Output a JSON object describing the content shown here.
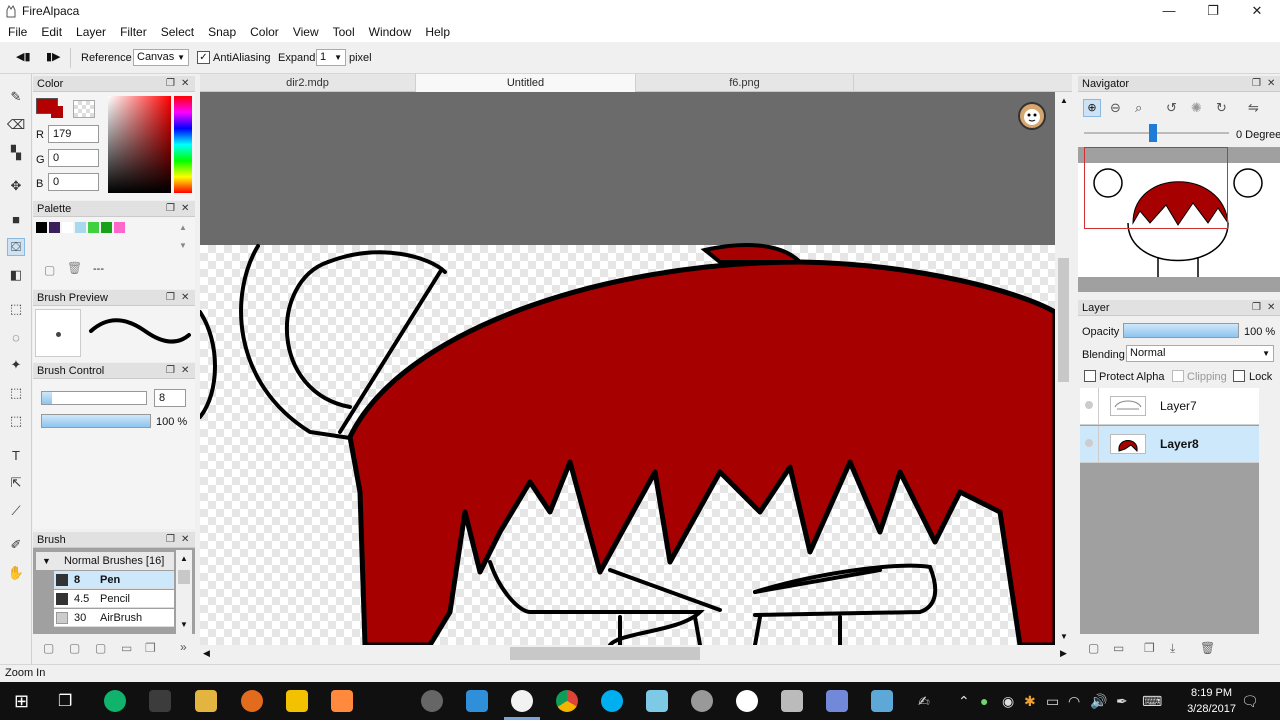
{
  "window": {
    "title": "FireAlpaca",
    "min": "—",
    "max": "❐",
    "close": "✕"
  },
  "menu": [
    "File",
    "Edit",
    "Layer",
    "Filter",
    "Select",
    "Snap",
    "Color",
    "View",
    "Tool",
    "Window",
    "Help"
  ],
  "options": {
    "reference_label": "Reference",
    "reference_value": "Canvas",
    "antialiasing_label": "AntiAliasing",
    "expand_label": "Expand",
    "expand_value": "1",
    "pixel_label": "pixel"
  },
  "panels": {
    "color": {
      "title": "Color",
      "r_label": "R",
      "r": "179",
      "g_label": "G",
      "g": "0",
      "b_label": "B",
      "b": "0",
      "primary": "#b30000"
    },
    "palette": {
      "title": "Palette",
      "more": "---",
      "swatches": [
        "#000000",
        "#3a1f5a",
        "#ffffff",
        "#a8d8f0",
        "#3fd13f",
        "#1aa11a",
        "#ff66cc"
      ]
    },
    "brush_preview": {
      "title": "Brush Preview"
    },
    "brush_control": {
      "title": "Brush Control",
      "size": "8",
      "size_fill": 0.1,
      "opacity": "100 %"
    },
    "brush": {
      "title": "Brush",
      "group": "Normal Brushes [16]",
      "items": [
        {
          "size": "8",
          "name": "Pen",
          "selected": true
        },
        {
          "size": "4.5",
          "name": "Pencil",
          "selected": false
        },
        {
          "size": "30",
          "name": "AirBrush",
          "selected": false
        }
      ]
    },
    "navigator": {
      "title": "Navigator",
      "rotation": "0 Degree"
    },
    "layer": {
      "title": "Layer",
      "opacity_label": "Opacity",
      "opacity": "100 %",
      "blending_label": "Blending",
      "blending": "Normal",
      "protect_alpha": "Protect Alpha",
      "clipping": "Clipping",
      "lock": "Lock",
      "layers": [
        {
          "name": "Layer7",
          "selected": false
        },
        {
          "name": "Layer8",
          "selected": true
        }
      ]
    }
  },
  "tabs": [
    {
      "label": "dir2.mdp",
      "active": false
    },
    {
      "label": "Untitled",
      "active": true
    },
    {
      "label": "f6.png",
      "active": false
    }
  ],
  "status": "Zoom In",
  "clock": {
    "time": "8:19 PM",
    "date": "3/28/2017"
  }
}
